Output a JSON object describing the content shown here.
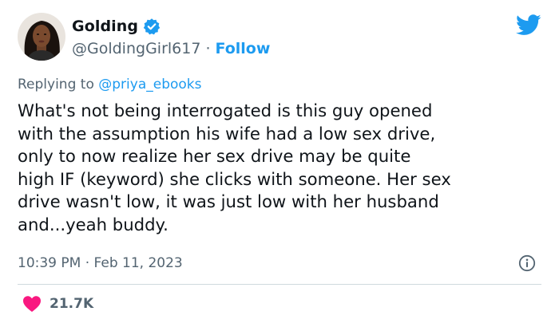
{
  "author": {
    "display_name": "Golding",
    "handle": "@GoldingGirl617",
    "separator": "·",
    "follow_label": "Follow",
    "verified": true
  },
  "reply": {
    "prefix": "Replying to ",
    "mention": "@priya_ebooks"
  },
  "tweet": {
    "lines": [
      "What's not being interrogated is this guy opened",
      "with the assumption his wife had a low sex drive,",
      "only to now realize her sex drive may be quite",
      "high IF (keyword) she clicks with someone. Her sex",
      "drive wasn't low, it was just low with her husband",
      "and...yeah buddy."
    ],
    "time": "10:39 PM",
    "separator": "·",
    "date": "Feb 11, 2023"
  },
  "engagement": {
    "likes": "21.7K"
  },
  "icons": {
    "verified": "verified-badge-icon",
    "logo": "twitter-bird-icon",
    "info": "info-icon",
    "like": "heart-icon"
  },
  "colors": {
    "accent": "#1d9bf0",
    "text": "#0f1419",
    "secondary": "#536471",
    "heart": "#f91880",
    "divider": "#cfd9de"
  }
}
